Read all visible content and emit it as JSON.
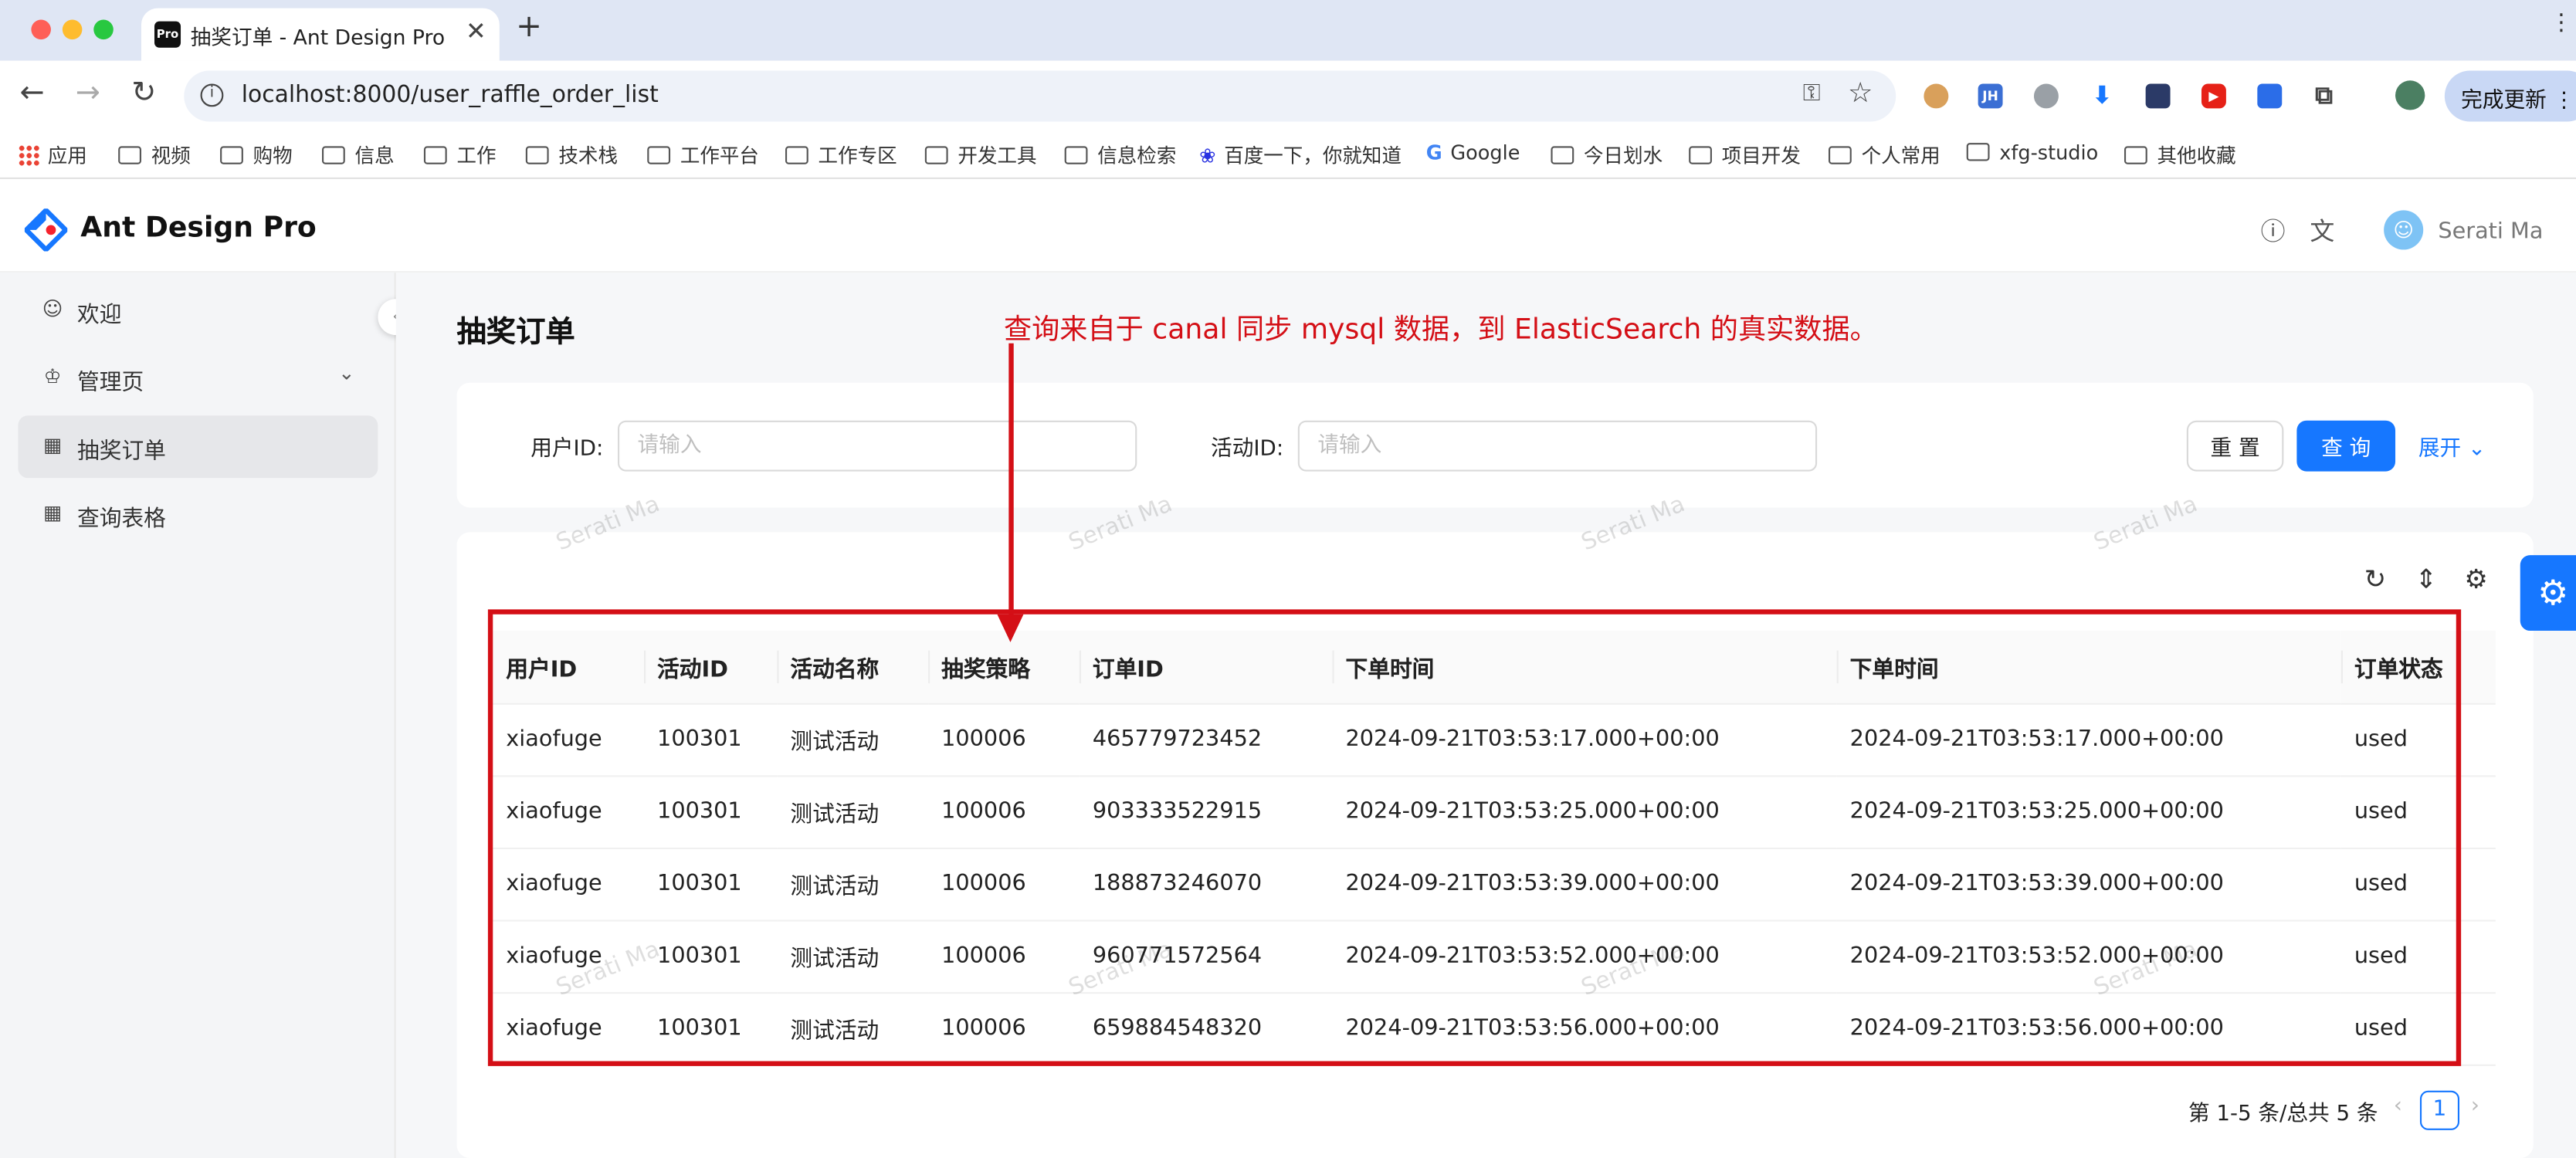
{
  "browser": {
    "tab_title": "抽奖订单 - Ant Design Pro",
    "tab_favicon": "Pro",
    "url": "localhost:8000/user_raffle_order_list",
    "update_button": "完成更新",
    "bookmarks": [
      "应用",
      "视频",
      "购物",
      "信息",
      "工作",
      "技术栈",
      "工作平台",
      "工作专区",
      "开发工具",
      "信息检索",
      "百度一下，你就知道",
      "Google",
      "今日划水",
      "项目开发",
      "个人常用",
      "xfg-studio",
      "其他收藏"
    ],
    "ext_labels": [
      "JH"
    ]
  },
  "app": {
    "title": "Ant Design Pro",
    "user_name": "Serati Ma"
  },
  "sidebar": {
    "items": [
      {
        "label": "欢迎",
        "icon": "smile-icon"
      },
      {
        "label": "管理页",
        "icon": "crown-icon"
      },
      {
        "label": "抽奖订单",
        "icon": "table-icon",
        "active": true
      },
      {
        "label": "查询表格",
        "icon": "table-icon"
      }
    ]
  },
  "page": {
    "title": "抽奖订单",
    "annotation": "查询来自于 canal 同步 mysql 数据，到 ElasticSearch 的真实数据。"
  },
  "search": {
    "user_id_label": "用户ID:",
    "user_id_placeholder": "请输入",
    "activity_id_label": "活动ID:",
    "activity_id_placeholder": "请输入",
    "reset_label": "重 置",
    "query_label": "查 询",
    "expand_label": "展开"
  },
  "table": {
    "columns": [
      "用户ID",
      "活动ID",
      "活动名称",
      "抽奖策略",
      "订单ID",
      "下单时间",
      "下单时间",
      "订单状态"
    ],
    "rows": [
      [
        "xiaofuge",
        "100301",
        "测试活动",
        "100006",
        "465779723452",
        "2024-09-21T03:53:17.000+00:00",
        "2024-09-21T03:53:17.000+00:00",
        "used"
      ],
      [
        "xiaofuge",
        "100301",
        "测试活动",
        "100006",
        "903333522915",
        "2024-09-21T03:53:25.000+00:00",
        "2024-09-21T03:53:25.000+00:00",
        "used"
      ],
      [
        "xiaofuge",
        "100301",
        "测试活动",
        "100006",
        "188873246070",
        "2024-09-21T03:53:39.000+00:00",
        "2024-09-21T03:53:39.000+00:00",
        "used"
      ],
      [
        "xiaofuge",
        "100301",
        "测试活动",
        "100006",
        "960771572564",
        "2024-09-21T03:53:52.000+00:00",
        "2024-09-21T03:53:52.000+00:00",
        "used"
      ],
      [
        "xiaofuge",
        "100301",
        "测试活动",
        "100006",
        "659884548320",
        "2024-09-21T03:53:56.000+00:00",
        "2024-09-21T03:53:56.000+00:00",
        "used"
      ]
    ]
  },
  "pagination": {
    "summary": "第 1-5 条/总共 5 条",
    "current_page": "1"
  },
  "watermark": "Serati Ma",
  "colors": {
    "primary": "#1677ff",
    "annotation_red": "#d40f16"
  }
}
